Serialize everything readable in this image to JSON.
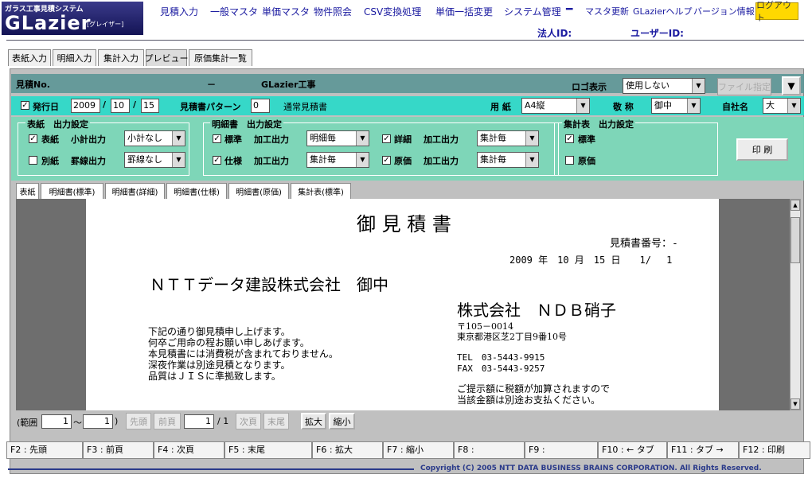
{
  "logo": {
    "subtitle": "ガラス工事見積システム",
    "name": "GLazier",
    "kana": "[グレイザー]"
  },
  "nav": {
    "items": [
      "見積入力",
      "一般マスタ",
      "単価マスタ",
      "物件照会",
      "CSV変換処理",
      "単価一括変更",
      "システム管理"
    ],
    "sub_items": [
      "マスタ更新",
      "GLazierヘルプ",
      "バージョン情報"
    ],
    "logout": "ログアウト",
    "corp_id_label": "法人ID:",
    "user_id_label": "ユーザーID:"
  },
  "tabs": [
    "表紙入力",
    "明細入力",
    "集計入力",
    "プレビュー",
    "原価集計一覧"
  ],
  "header": {
    "estimate_no_label": "見積No.",
    "dash": "－",
    "project": "GLazier工事",
    "logo_label": "ロゴ表示",
    "logo_value": "使用しない",
    "file_button": "ファイル指定",
    "toggle_icon": "▼"
  },
  "issue_row": {
    "issue_date_label": "発行日",
    "year": "2009",
    "month": "10",
    "day": "15",
    "slash": "/",
    "pattern_label": "見積書パターン",
    "pattern_value": "0",
    "pattern_name": "通常見積書",
    "paper_label": "用 紙",
    "paper_value": "A4縦",
    "honorific_label": "敬 称",
    "honorific_value": "御中",
    "company_label": "自社名",
    "company_value": "大"
  },
  "output": {
    "cover_title": "表紙　出力設定",
    "cover_items": [
      {
        "label": "表紙",
        "check": "✓",
        "field": "小計出力",
        "value": "小計なし"
      },
      {
        "label": "別紙",
        "check": "",
        "field": "罫線出力",
        "value": "罫線なし"
      }
    ],
    "detail_title": "明細書　出力設定",
    "detail_items": [
      {
        "label": "標準",
        "check": "✓",
        "field": "加工出力",
        "value": "明細毎"
      },
      {
        "label": "詳細",
        "check": "✓",
        "field": "加工出力",
        "value": "集計毎"
      },
      {
        "label": "仕様",
        "check": "✓",
        "field": "加工出力",
        "value": "集計毎"
      },
      {
        "label": "原価",
        "check": "✓",
        "field": "加工出力",
        "value": "集計毎"
      }
    ],
    "summary_title": "集計表　出力設定",
    "summary_items": [
      {
        "label": "標準",
        "check": "✓"
      },
      {
        "label": "原価",
        "check": ""
      }
    ],
    "print_button": "印 刷"
  },
  "preview_tabs": [
    "表紙",
    "明細書(標準)",
    "明細書(詳細)",
    "明細書(仕様)",
    "明細書(原価)",
    "集計表(標準)"
  ],
  "document": {
    "title": "御 見 積 書",
    "number_label": "見積書番号：-",
    "date_line": "2009 年　10 月　15 日　　1/　 1",
    "client": "ＮＴＴデータ建設株式会社　御中",
    "company": "株式会社　ＮＤＢ硝子",
    "postal": "〒105－0014",
    "address": "東京都港区芝2丁目9番10号",
    "tel": "TEL　03-5443-9915",
    "fax": "FAX　03-5443-9257",
    "notes": [
      "下記の通り御見積申し上げます。",
      "何卒ご用命の程お願い申しあげます。",
      "本見積書には消費税が含まれておりません。",
      "深夜作業は別途見積となります。",
      "品質はＪＩＳに準拠致します。"
    ],
    "tax_notes": [
      "ご提示額に税額が加算されますので",
      "当該金額は別途お支払ください。"
    ]
  },
  "pager": {
    "range_label": "(範囲",
    "from": "1",
    "tilde": "～",
    "to": "1",
    "close": ")",
    "first": "先頭",
    "prev": "前頁",
    "page": "1",
    "total": "/ 1",
    "next": "次頁",
    "last": "末尾",
    "zoom_in": "拡大",
    "zoom_out": "縮小"
  },
  "fkeys": [
    "F2 : 先頭",
    "F3 : 前頁",
    "F4 : 次頁",
    "F5 : 末尾",
    "F6 : 拡大",
    "F7 : 縮小",
    "F8 :",
    "F9 :",
    "F10 : ← タブ",
    "F11 : タブ →",
    "F12 : 印刷"
  ],
  "footer": "Copyright (C) 2005 NTT DATA BUSINESS BRAINS CORPORATION. All Rights Reserved."
}
